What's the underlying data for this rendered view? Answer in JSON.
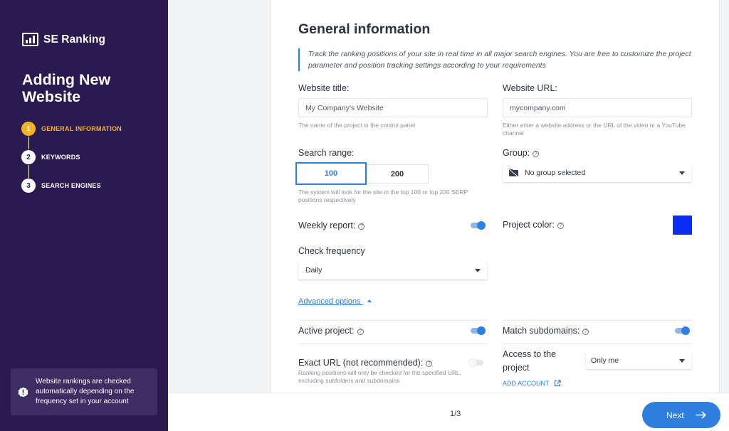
{
  "sidebar": {
    "logo": "SE Ranking",
    "title": "Adding New Website",
    "steps": [
      {
        "num": "1",
        "label": "GENERAL INFORMATION"
      },
      {
        "num": "2",
        "label": "KEYWORDS"
      },
      {
        "num": "3",
        "label": "SEARCH ENGINES"
      }
    ],
    "notice": "Website rankings are checked automatically depending on the frequency set in your account"
  },
  "form": {
    "title": "General information",
    "intro": "Track the ranking positions of your site in real time in all major search engines. You are free to customize the project parameter and position tracking settings according to your requirements",
    "website_title": {
      "label": "Website title:",
      "placeholder": "My Company's Website",
      "help": "The name of the project in the control panel"
    },
    "website_url": {
      "label": "Website URL:",
      "placeholder": "mycompany.com",
      "help": "Either enter a website address or the URL of the video or a YouTube channel"
    },
    "search_range": {
      "label": "Search range:",
      "options": [
        "100",
        "200"
      ],
      "selected": "100",
      "help": "The system will look for the site in the top 100 or top 200 SERP positions respectively"
    },
    "group": {
      "label": "Group:",
      "value": "No group selected"
    },
    "weekly_report": {
      "label": "Weekly report:",
      "on": true
    },
    "project_color": {
      "label": "Project color:",
      "value": "#0a2cf5"
    },
    "check_frequency": {
      "label": "Check frequency",
      "value": "Daily"
    },
    "advanced_options": "Advanced options",
    "active_project": {
      "label": "Active project:",
      "on": true
    },
    "match_subdomains": {
      "label": "Match subdomains:",
      "on": true
    },
    "exact_url": {
      "label": "Exact URL (not recommended):",
      "help": "Ranking positions will only be checked for the specified URL, excluding subfolders and subdomains",
      "on": false
    },
    "access": {
      "label": "Access to the project",
      "value": "Only me",
      "add_account": "ADD ACCOUNT"
    }
  },
  "footer": {
    "page": "1/3",
    "next": "Next"
  },
  "colors": {
    "sidebar_bg": "#2b1a4f",
    "accent": "#2f7ee0",
    "step_active": "#f5b323"
  }
}
